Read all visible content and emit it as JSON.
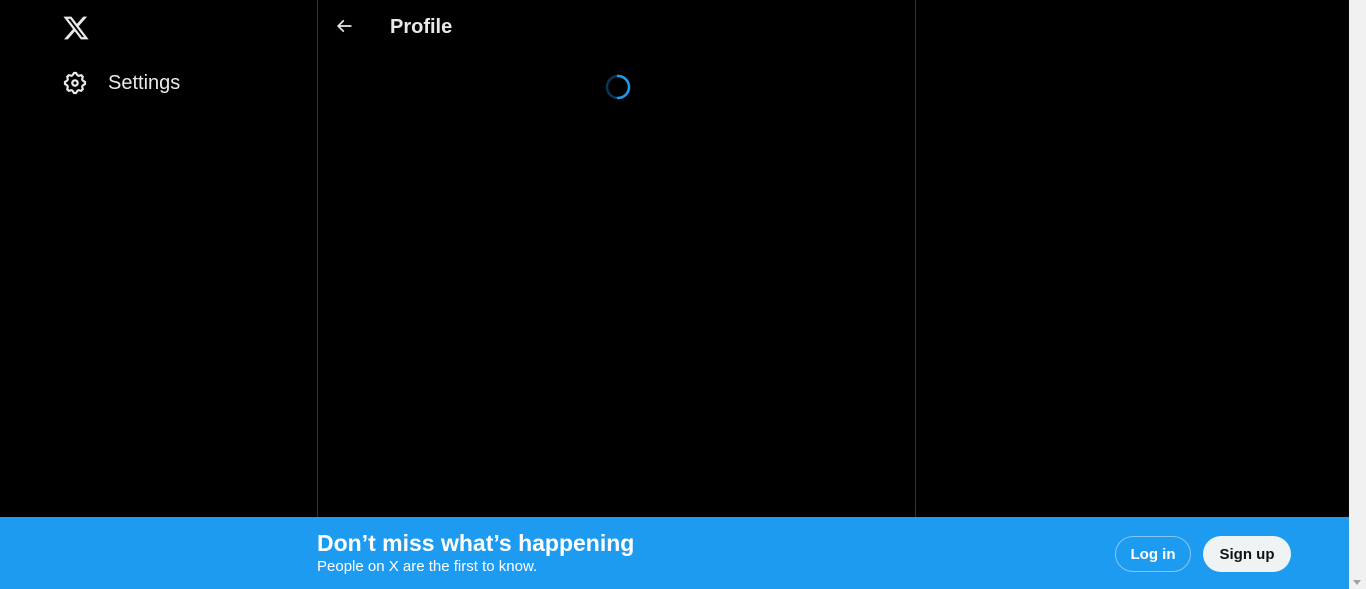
{
  "sidebar": {
    "logo_icon": "x-logo-icon",
    "items": [
      {
        "label": "Settings",
        "icon": "gear-icon"
      }
    ]
  },
  "header": {
    "back_icon": "arrow-left-icon",
    "title": "Profile"
  },
  "main": {
    "loading_indicator": "spinner"
  },
  "bottom_bar": {
    "title": "Don’t miss what’s happening",
    "subtitle": "People on X are the first to know.",
    "login_label": "Log in",
    "signup_label": "Sign up"
  },
  "colors": {
    "background": "#000000",
    "text": "#e7e9ea",
    "accent": "#1d9bf0",
    "border": "#2f3336",
    "signup_bg": "#eff3f4"
  }
}
